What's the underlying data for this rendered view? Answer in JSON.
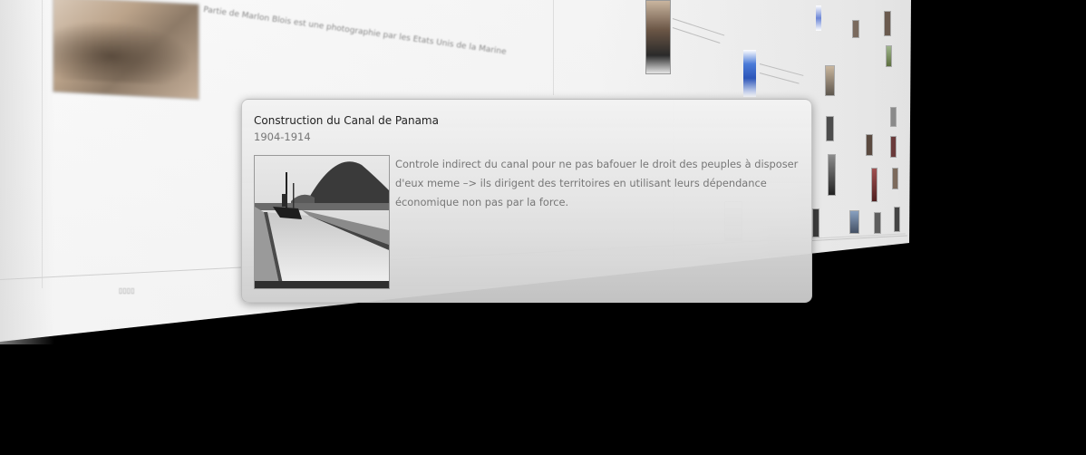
{
  "event_popup": {
    "title": "Construction du Canal de Panama",
    "date_range": "1904-1914",
    "description": "Controle indirect du canal pour ne pas bafouer le droit des peuples à disposer d'eux meme –> ils dirigent des territoires en utilisant leurs dépendance économique non pas par la force.",
    "image_icon": "canal-photo"
  },
  "timeline": {
    "background_blurred_text": "Partie de Marlon Blois est une photographie par les Etats Unis de la Marine"
  },
  "colors": {
    "background": "#000000",
    "card_title": "#222222",
    "card_text": "#777777",
    "plane": "#f4f4f4"
  }
}
